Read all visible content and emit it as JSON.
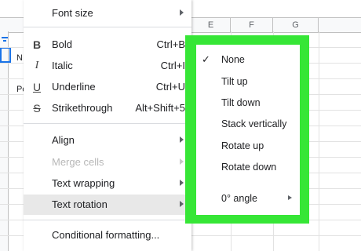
{
  "sheet": {
    "columns": [
      "E",
      "F",
      "G"
    ],
    "cells": {
      "n_fragment": "N",
      "p_fragment": "Po"
    }
  },
  "format_menu": {
    "items": [
      {
        "id": "font-size",
        "label": "Font size",
        "submenu": true
      },
      {
        "id": "bold",
        "label": "Bold",
        "icon": "bold-icon",
        "icon_glyph": "B",
        "shortcut": "Ctrl+B"
      },
      {
        "id": "italic",
        "label": "Italic",
        "icon": "italic-icon",
        "icon_glyph": "I",
        "shortcut": "Ctrl+I"
      },
      {
        "id": "underline",
        "label": "Underline",
        "icon": "underline-icon",
        "icon_glyph": "U",
        "shortcut": "Ctrl+U"
      },
      {
        "id": "strikethrough",
        "label": "Strikethrough",
        "icon": "strikethrough-icon",
        "icon_glyph": "S",
        "shortcut": "Alt+Shift+5"
      },
      {
        "id": "align",
        "label": "Align",
        "submenu": true
      },
      {
        "id": "merge-cells",
        "label": "Merge cells",
        "submenu": true,
        "disabled": true
      },
      {
        "id": "text-wrapping",
        "label": "Text wrapping",
        "submenu": true
      },
      {
        "id": "text-rotation",
        "label": "Text rotation",
        "submenu": true,
        "highlighted": true
      },
      {
        "id": "conditional-formatting",
        "label": "Conditional formatting..."
      }
    ]
  },
  "rotation_menu": {
    "items": [
      {
        "id": "none",
        "label": "None",
        "checked": true,
        "check_glyph": "✓"
      },
      {
        "id": "tilt-up",
        "label": "Tilt up"
      },
      {
        "id": "tilt-down",
        "label": "Tilt down"
      },
      {
        "id": "stack-vertically",
        "label": "Stack vertically"
      },
      {
        "id": "rotate-up",
        "label": "Rotate up"
      },
      {
        "id": "rotate-down",
        "label": "Rotate down"
      },
      {
        "id": "angle",
        "label": "0° angle",
        "submenu": true
      }
    ]
  },
  "colors": {
    "highlight_frame": "#36e636",
    "selection_blue": "#1a73e8",
    "menu_hover": "#e8e8e8",
    "disabled_text": "#b7b7b7"
  }
}
